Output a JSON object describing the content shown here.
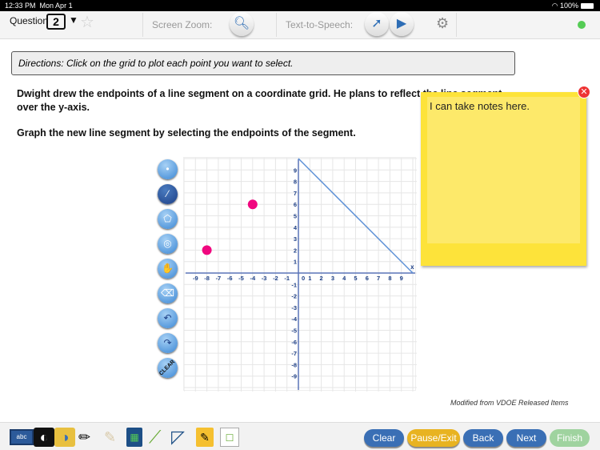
{
  "status": {
    "time": "12:33 PM",
    "date": "Mon Apr 1",
    "battery": "100%"
  },
  "toolbar": {
    "question_label": "Question",
    "question_number": "2",
    "screen_zoom": "Screen Zoom:",
    "tts": "Text-to-Speech:"
  },
  "directions": "Directions: Click on the grid to plot each point you want to select.",
  "question": {
    "line1": "Dwight drew the endpoints of a line segment on a coordinate grid. He plans to reflect the line segment",
    "line2": "over the y-axis.",
    "line3": "Graph the new line segment by selecting the endpoints of the segment."
  },
  "tools": [
    "point-tool",
    "line-tool",
    "polygon-tool",
    "circle-tool",
    "hand-tool",
    "eraser-tool",
    "undo",
    "redo",
    "clear"
  ],
  "tool_clear_label": "CLEAR",
  "graph": {
    "xmin": -10,
    "xmax": 10,
    "ymin": -10,
    "ymax": 10,
    "axis_label_x": "x",
    "points": [
      [
        -8,
        2
      ],
      [
        -4,
        6
      ]
    ],
    "point_color": "#f0077f",
    "segment": [
      [
        0,
        10
      ],
      [
        10,
        0
      ]
    ],
    "segment_color": "#5b8fd6"
  },
  "note": {
    "text": "I can take notes here."
  },
  "credit": "Modified from VDOE Released Items",
  "bottom": {
    "clear": "Clear",
    "pause": "Pause/Exit",
    "back": "Back",
    "next": "Next",
    "finish": "Finish"
  },
  "colors": {
    "blue": "#3a6fb5",
    "gold": "#e8b321",
    "finish": "#9fd39f",
    "note": "#fde33a"
  }
}
